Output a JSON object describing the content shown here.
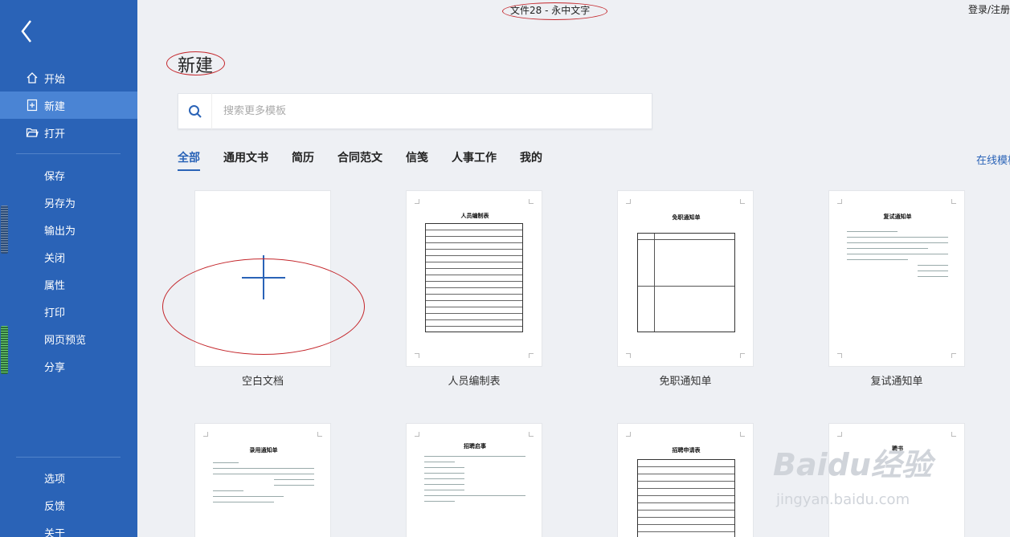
{
  "window": {
    "title": "文件28 - 永中文字",
    "login_label": "登录/注册"
  },
  "sidebar": {
    "nav_top": [
      {
        "label": "开始",
        "icon": "home-icon"
      },
      {
        "label": "新建",
        "icon": "new-document-icon",
        "active": true
      },
      {
        "label": "打开",
        "icon": "folder-open-icon"
      }
    ],
    "nav_middle": [
      "保存",
      "另存为",
      "输出为",
      "关闭",
      "属性",
      "打印",
      "网页预览",
      "分享"
    ],
    "nav_bottom": [
      "选项",
      "反馈",
      "关于"
    ]
  },
  "main": {
    "heading": "新建",
    "search": {
      "placeholder": "搜索更多模板"
    },
    "tabs": [
      {
        "label": "全部",
        "active": true
      },
      {
        "label": "通用文书"
      },
      {
        "label": "简历"
      },
      {
        "label": "合同范文"
      },
      {
        "label": "信笺"
      },
      {
        "label": "人事工作"
      },
      {
        "label": "我的"
      }
    ],
    "online_templates_label": "在线模板",
    "templates_row1": [
      {
        "label": "空白文档"
      },
      {
        "label": "人员编制表",
        "doc_title": "人员编制表"
      },
      {
        "label": "免职通知单",
        "doc_title": "免职通知单"
      },
      {
        "label": "复试通知单",
        "doc_title": "复试通知单"
      }
    ],
    "templates_row2": [
      {
        "doc_title": "录用通知单"
      },
      {
        "doc_title": "招聘启事"
      },
      {
        "doc_title": "招聘申请表"
      },
      {
        "doc_title": "聘书"
      }
    ]
  },
  "watermark": {
    "brand": "Baidu经验",
    "url": "jingyan.baidu.com"
  },
  "colors": {
    "sidebar": "#2a63b7",
    "accent": "#2a63b7",
    "annotation": "#c4262b",
    "background": "#eef0f4"
  }
}
